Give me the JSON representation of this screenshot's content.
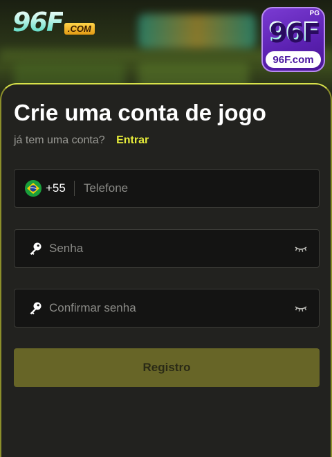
{
  "header": {
    "logo_text": "96F",
    "logo_suffix": ".COM",
    "app_icon": {
      "badge": "PG",
      "big_text": "96F",
      "small_text": "96F.com"
    }
  },
  "form": {
    "title": "Crie uma conta de jogo",
    "login_prompt": "já tem uma conta?",
    "login_link": "Entrar",
    "phone": {
      "country_flag": "brazil-flag",
      "country_code": "+55",
      "placeholder": "Telefone"
    },
    "password": {
      "icon": "key-icon",
      "placeholder": "Senha",
      "toggle_icon": "eye-closed-icon"
    },
    "confirm_password": {
      "icon": "key-icon",
      "placeholder": "Confirmar senha",
      "toggle_icon": "eye-closed-icon"
    },
    "submit_label": "Registro"
  },
  "colors": {
    "accent": "#e8ee3a",
    "button": "#676527",
    "card": "#22221f"
  }
}
